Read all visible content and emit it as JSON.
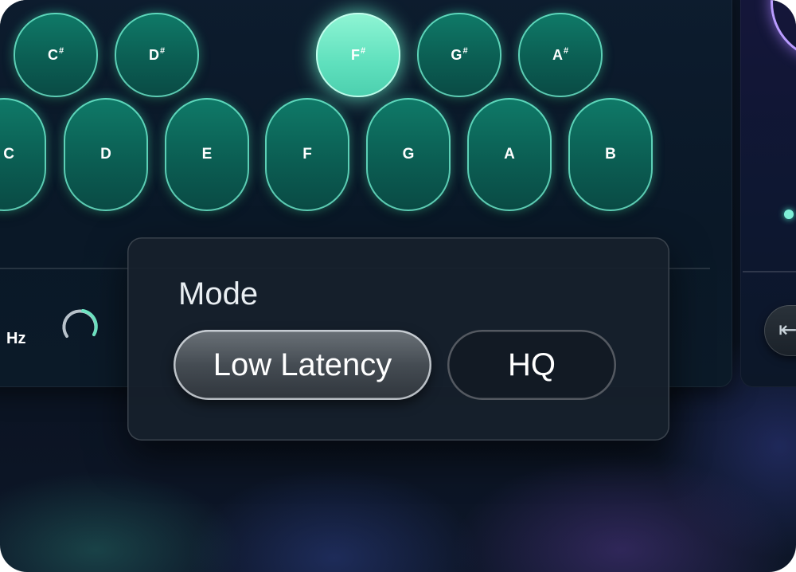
{
  "keyboard": {
    "black_keys": [
      {
        "note": "C",
        "accidental": "#",
        "active": false
      },
      {
        "note": "D",
        "accidental": "#",
        "active": false
      },
      {
        "note": "F",
        "accidental": "#",
        "active": true
      },
      {
        "note": "G",
        "accidental": "#",
        "active": false
      },
      {
        "note": "A",
        "accidental": "#",
        "active": false
      }
    ],
    "white_keys": [
      "C",
      "D",
      "E",
      "F",
      "G",
      "A",
      "B"
    ]
  },
  "controls": {
    "frequency_unit": "Hz",
    "knob_icon": "knob-icon"
  },
  "mode_popover": {
    "title": "Mode",
    "options": [
      "Low Latency",
      "HQ"
    ],
    "selected": "Low Latency"
  },
  "side_panel": {
    "back_icon": "arrow-left-icon",
    "indicator_color": "#7ff0d8",
    "ring_color": "#b99cff"
  },
  "colors": {
    "key_fill": "#0b5e53",
    "key_glow": "#78f5d7",
    "key_active": "#6fe6c4",
    "background": "#0b1524"
  }
}
